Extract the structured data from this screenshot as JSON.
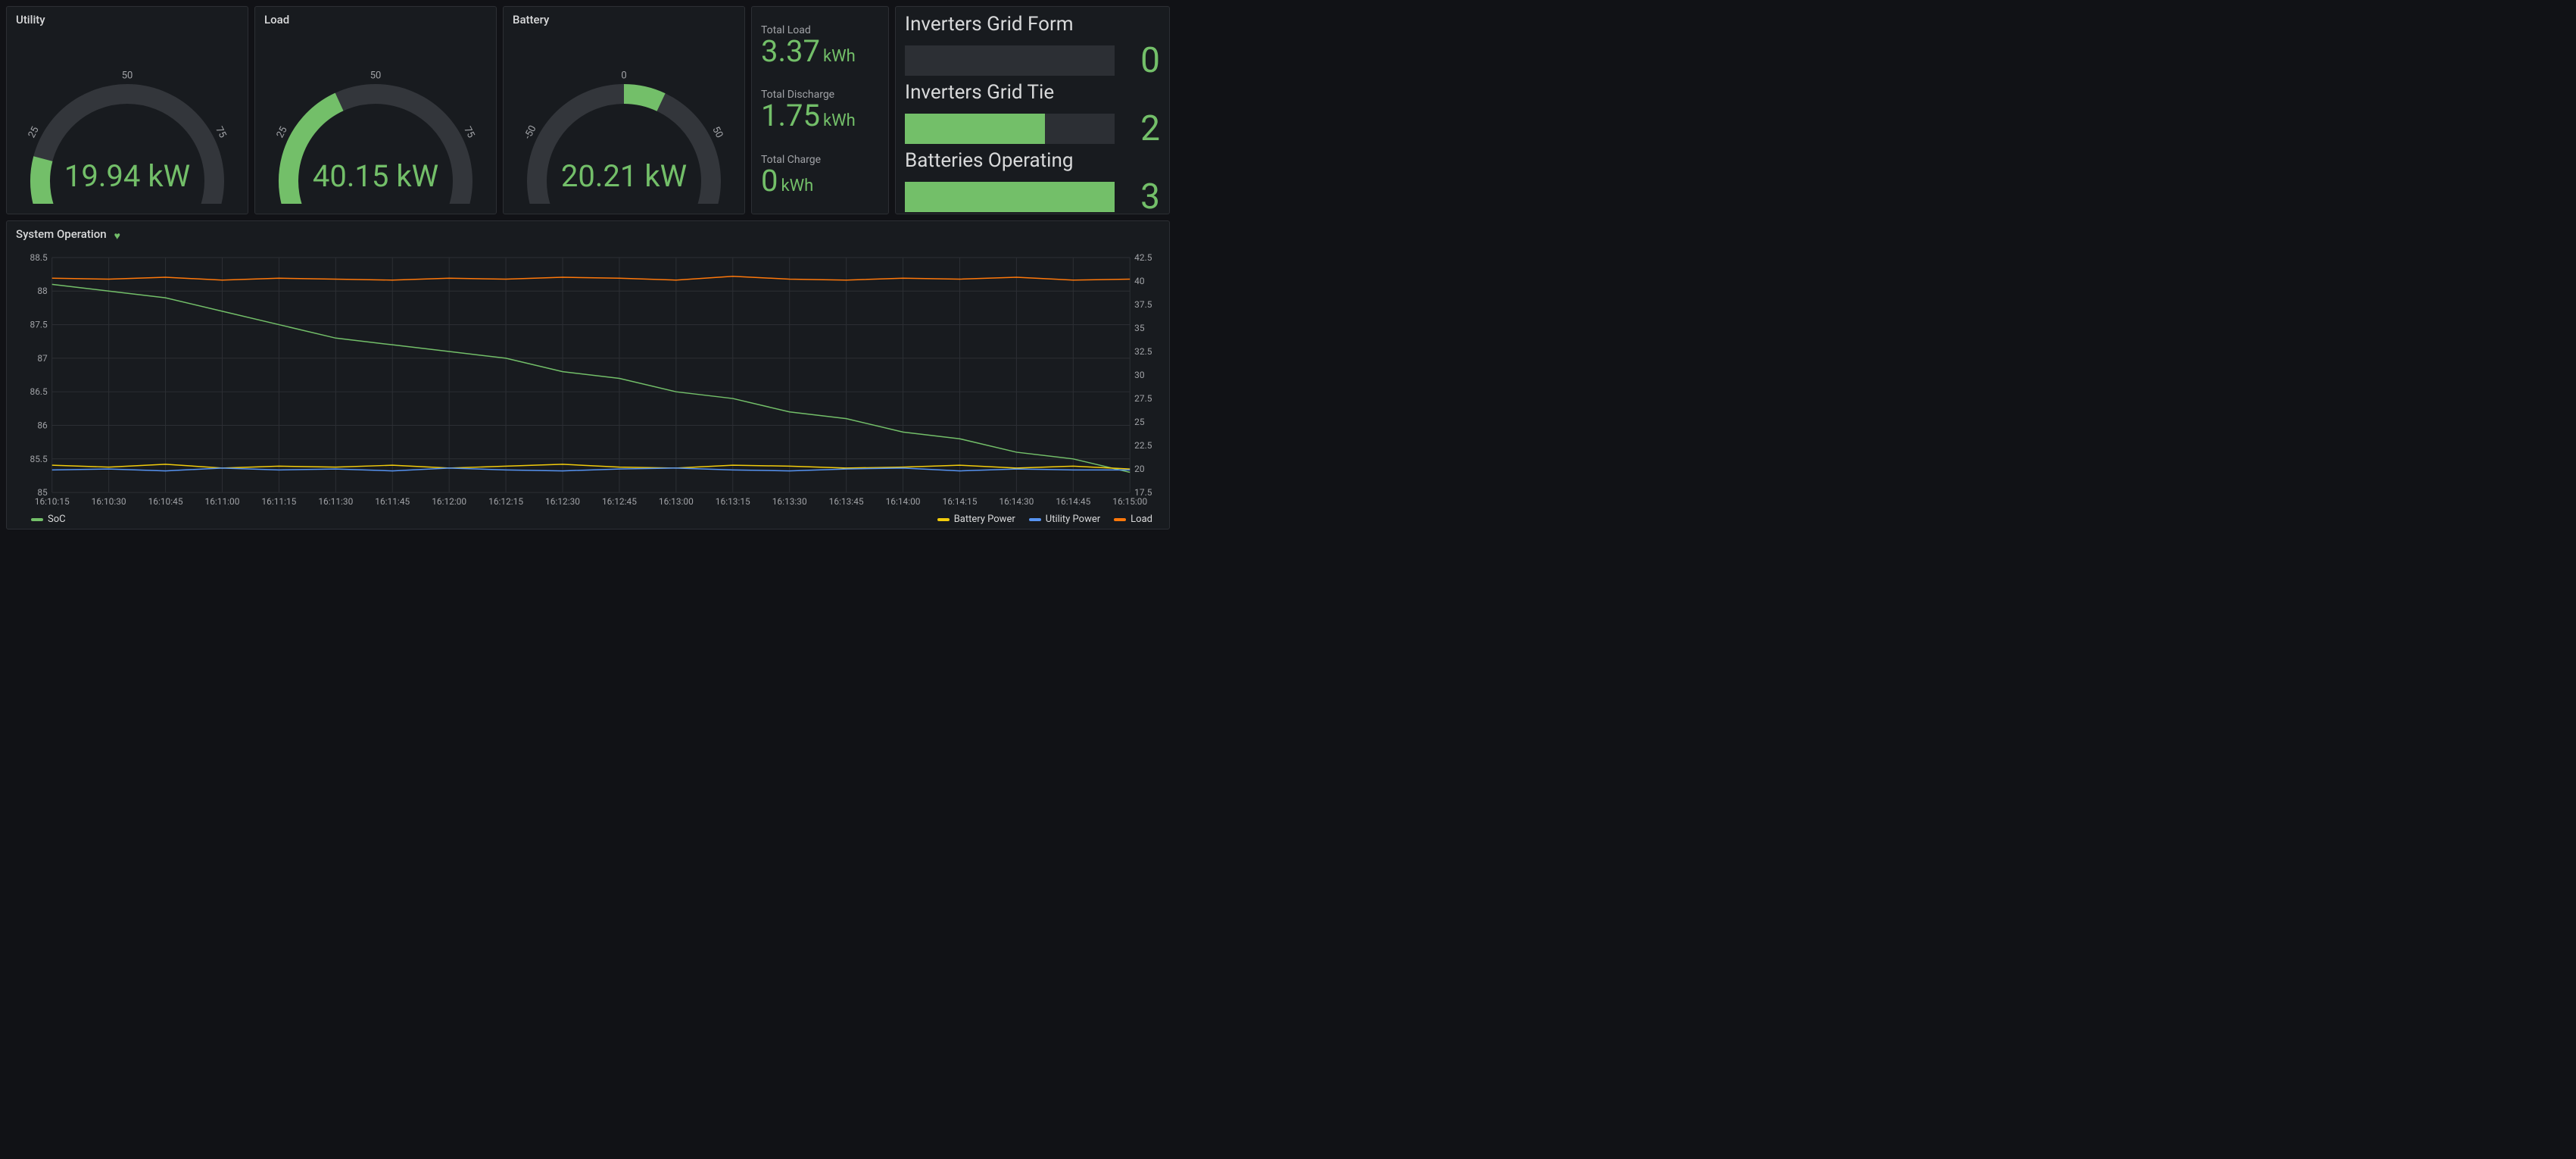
{
  "colors": {
    "green": "#73bf69",
    "gaugeTrack": "#33363b",
    "yellow": "#f2cc0c",
    "blue": "#5794f2",
    "orange": "#ff780a"
  },
  "gauges": [
    {
      "title": "Utility",
      "value": 19.94,
      "unit": "kW",
      "min": 0,
      "max": 100,
      "ticks": [
        "0",
        "25",
        "50",
        "75",
        "100"
      ]
    },
    {
      "title": "Load",
      "value": 40.15,
      "unit": "kW",
      "min": 0,
      "max": 100,
      "ticks": [
        "0",
        "25",
        "50",
        "75",
        "100"
      ]
    },
    {
      "title": "Battery",
      "value": 20.21,
      "unit": "kW",
      "min": -100,
      "max": 100,
      "ticks": [
        "-100",
        "-50",
        "0",
        "50",
        "100"
      ]
    }
  ],
  "stats": [
    {
      "label": "Total Load",
      "value": "3.37",
      "unit": "kWh"
    },
    {
      "label": "Total Discharge",
      "value": "1.75",
      "unit": "kWh"
    },
    {
      "label": "Total Charge",
      "value": "0",
      "unit": "kWh"
    }
  ],
  "bars": [
    {
      "label": "Inverters Grid Form",
      "value": 0,
      "max": 3
    },
    {
      "label": "Inverters Grid Tie",
      "value": 2,
      "max": 3
    },
    {
      "label": "Batteries Operating",
      "value": 3,
      "max": 3
    }
  ],
  "chart": {
    "title": "System Operation",
    "legend_left": [
      {
        "name": "SoC",
        "color": "#73bf69"
      }
    ],
    "legend_right": [
      {
        "name": "Battery Power",
        "color": "#f2cc0c"
      },
      {
        "name": "Utility Power",
        "color": "#5794f2"
      },
      {
        "name": "Load",
        "color": "#ff780a"
      }
    ]
  },
  "chart_data": {
    "type": "line",
    "title": "System Operation",
    "xlabel": "",
    "x": [
      "16:10:15",
      "16:10:30",
      "16:10:45",
      "16:11:00",
      "16:11:15",
      "16:11:30",
      "16:11:45",
      "16:12:00",
      "16:12:15",
      "16:12:30",
      "16:12:45",
      "16:13:00",
      "16:13:15",
      "16:13:30",
      "16:13:45",
      "16:14:00",
      "16:14:15",
      "16:14:30",
      "16:14:45",
      "16:15:00"
    ],
    "y_left": {
      "label": "",
      "lim": [
        85,
        88.5
      ],
      "ticks": [
        85,
        85.5,
        86,
        86.5,
        87,
        87.5,
        88,
        88.5
      ]
    },
    "y_right": {
      "label": "",
      "lim": [
        17.5,
        42.5
      ],
      "ticks": [
        17.5,
        20,
        22.5,
        25,
        27.5,
        30,
        32.5,
        35,
        37.5,
        40,
        42.5
      ]
    },
    "series": [
      {
        "name": "SoC",
        "axis": "left",
        "color": "#73bf69",
        "values": [
          88.1,
          88.0,
          87.9,
          87.7,
          87.5,
          87.3,
          87.2,
          87.1,
          87.0,
          86.8,
          86.7,
          86.5,
          86.4,
          86.2,
          86.1,
          85.9,
          85.8,
          85.6,
          85.5,
          85.3
        ]
      },
      {
        "name": "Load",
        "axis": "right",
        "color": "#ff780a",
        "values": [
          40.3,
          40.2,
          40.4,
          40.1,
          40.3,
          40.2,
          40.1,
          40.3,
          40.2,
          40.4,
          40.3,
          40.1,
          40.5,
          40.2,
          40.1,
          40.3,
          40.2,
          40.4,
          40.1,
          40.2
        ]
      },
      {
        "name": "Battery Power",
        "axis": "right",
        "color": "#f2cc0c",
        "values": [
          20.4,
          20.2,
          20.5,
          20.1,
          20.3,
          20.2,
          20.4,
          20.1,
          20.3,
          20.5,
          20.2,
          20.1,
          20.4,
          20.3,
          20.1,
          20.2,
          20.4,
          20.1,
          20.3,
          20.0
        ]
      },
      {
        "name": "Utility Power",
        "axis": "right",
        "color": "#5794f2",
        "values": [
          19.9,
          20.0,
          19.8,
          20.1,
          19.9,
          20.0,
          19.8,
          20.1,
          19.9,
          19.8,
          20.0,
          20.1,
          19.9,
          19.8,
          20.0,
          20.1,
          19.8,
          20.0,
          19.9,
          19.9
        ]
      }
    ]
  }
}
